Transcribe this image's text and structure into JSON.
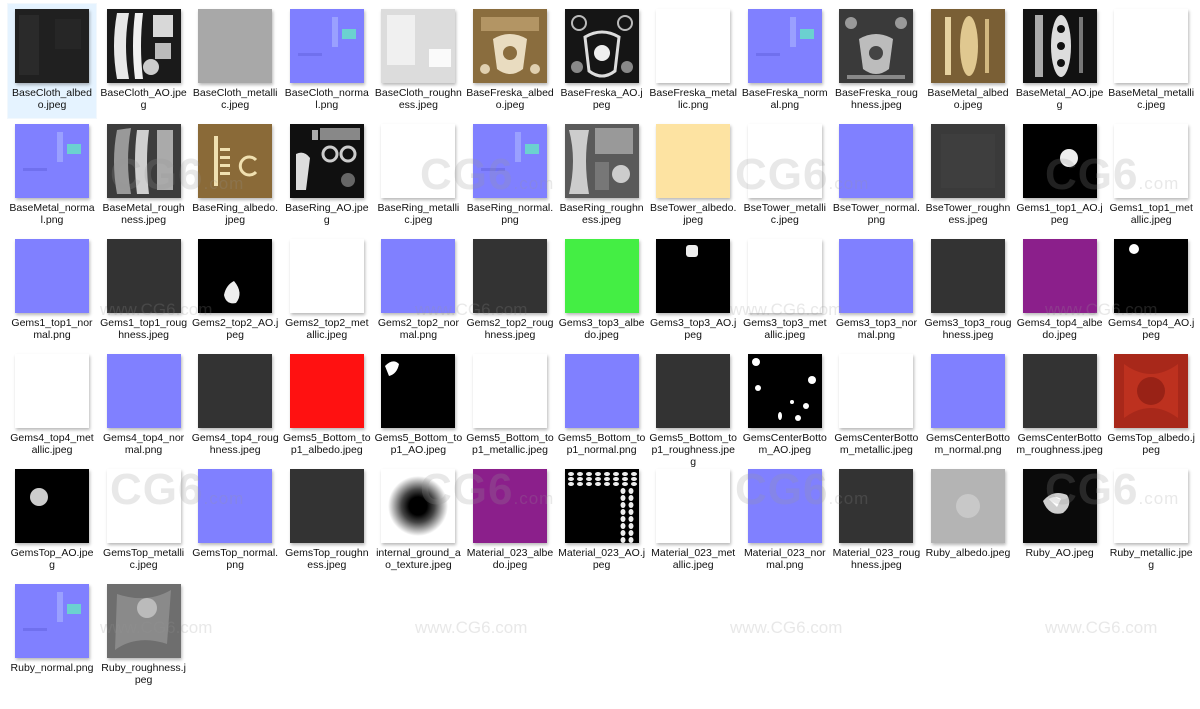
{
  "files": [
    {
      "name": "BaseCloth_albedo.jpeg",
      "selected": true,
      "bg": "#202020",
      "pattern": "dark-cloth"
    },
    {
      "name": "BaseCloth_AO.jpeg",
      "bg": "#1a1a1a",
      "pattern": "ao-cloth"
    },
    {
      "name": "BaseCloth_metallic.jpeg",
      "bg": "#a8a8a8",
      "pattern": "flat"
    },
    {
      "name": "BaseCloth_normal.png",
      "bg": "#7f7fff",
      "pattern": "normal-detail"
    },
    {
      "name": "BaseCloth_roughness.jpeg",
      "bg": "#dcdcdc",
      "pattern": "rough-cloth"
    },
    {
      "name": "BaseFreska_albedo.jpeg",
      "bg": "#8a6d3e",
      "pattern": "freska-gold"
    },
    {
      "name": "BaseFreska_AO.jpeg",
      "bg": "#151515",
      "pattern": "freska-ao"
    },
    {
      "name": "BaseFreska_metallic.png",
      "bg": "#ffffff",
      "pattern": "flat"
    },
    {
      "name": "BaseFreska_normal.png",
      "bg": "#8080ff",
      "pattern": "normal-detail"
    },
    {
      "name": "BaseFreska_roughness.jpeg",
      "bg": "#3a3a3a",
      "pattern": "freska-rough"
    },
    {
      "name": "BaseMetal_albedo.jpeg",
      "bg": "#7a5f35",
      "pattern": "metal-gold"
    },
    {
      "name": "BaseMetal_AO.jpeg",
      "bg": "#111111",
      "pattern": "metal-ao"
    },
    {
      "name": "BaseMetal_metallic.jpeg",
      "bg": "#ffffff",
      "pattern": "flat"
    },
    {
      "name": "BaseMetal_normal.png",
      "bg": "#8080ff",
      "pattern": "normal-detail"
    },
    {
      "name": "BaseMetal_roughness.jpeg",
      "bg": "#3c3c3c",
      "pattern": "metal-rough"
    },
    {
      "name": "BaseRing_albedo.jpeg",
      "bg": "#8a6a38",
      "pattern": "ring-gold"
    },
    {
      "name": "BaseRing_AO.jpeg",
      "bg": "#101010",
      "pattern": "ring-ao"
    },
    {
      "name": "BaseRing_metallic.jpeg",
      "bg": "#ffffff",
      "pattern": "flat"
    },
    {
      "name": "BaseRing_normal.png",
      "bg": "#8080ff",
      "pattern": "normal-detail"
    },
    {
      "name": "BaseRing_roughness.jpeg",
      "bg": "#5a5a5a",
      "pattern": "ring-rough"
    },
    {
      "name": "BseTower_albedo.jpeg",
      "bg": "#fde3a2",
      "pattern": "flat"
    },
    {
      "name": "BseTower_metallic.jpeg",
      "bg": "#ffffff",
      "pattern": "flat"
    },
    {
      "name": "BseTower_normal.png",
      "bg": "#8080ff",
      "pattern": "flat"
    },
    {
      "name": "BseTower_roughness.jpeg",
      "bg": "#3a3a3a",
      "pattern": "noise"
    },
    {
      "name": "Gems1_top1_AO.jpeg",
      "bg": "#000000",
      "pattern": "gem-dot-mid"
    },
    {
      "name": "Gems1_top1_metallic.jpeg",
      "bg": "#ffffff",
      "pattern": "flat"
    },
    {
      "name": "Gems1_top1_normal.png",
      "bg": "#8080ff",
      "pattern": "flat"
    },
    {
      "name": "Gems1_top1_roughness.jpeg",
      "bg": "#333333",
      "pattern": "flat"
    },
    {
      "name": "Gems2_top2_AO.jpeg",
      "bg": "#000000",
      "pattern": "gem-drop"
    },
    {
      "name": "Gems2_top2_metallic.jpeg",
      "bg": "#ffffff",
      "pattern": "flat"
    },
    {
      "name": "Gems2_top2_normal.png",
      "bg": "#8080ff",
      "pattern": "flat"
    },
    {
      "name": "Gems2_top2_roughness.jpeg",
      "bg": "#333333",
      "pattern": "flat"
    },
    {
      "name": "Gems3_top3_albedo.jpeg",
      "bg": "#44ee44",
      "pattern": "flat"
    },
    {
      "name": "Gems3_top3_AO.jpeg",
      "bg": "#000000",
      "pattern": "gem-square"
    },
    {
      "name": "Gems3_top3_metallic.jpeg",
      "bg": "#ffffff",
      "pattern": "flat"
    },
    {
      "name": "Gems3_top3_normal.png",
      "bg": "#8080ff",
      "pattern": "flat"
    },
    {
      "name": "Gems3_top3_roughness.jpeg",
      "bg": "#333333",
      "pattern": "flat"
    },
    {
      "name": "Gems4_top4_albedo.jpeg",
      "bg": "#8b1f8b",
      "pattern": "flat"
    },
    {
      "name": "Gems4_top4_AO.jpeg",
      "bg": "#000000",
      "pattern": "gem-dot-corner"
    },
    {
      "name": "Gems4_top4_metallic.jpeg",
      "bg": "#ffffff",
      "pattern": "flat"
    },
    {
      "name": "Gems4_top4_normal.png",
      "bg": "#8080ff",
      "pattern": "flat"
    },
    {
      "name": "Gems4_top4_roughness.jpeg",
      "bg": "#333333",
      "pattern": "flat"
    },
    {
      "name": "Gems5_Bottom_top1_albedo.jpeg",
      "bg": "#ff1111",
      "pattern": "flat"
    },
    {
      "name": "Gems5_Bottom_top1_AO.jpeg",
      "bg": "#000000",
      "pattern": "gem-blob"
    },
    {
      "name": "Gems5_Bottom_top1_metallic.jpeg",
      "bg": "#ffffff",
      "pattern": "flat"
    },
    {
      "name": "Gems5_Bottom_top1_normal.png",
      "bg": "#8080ff",
      "pattern": "flat"
    },
    {
      "name": "Gems5_Bottom_top1_roughness.jpeg",
      "bg": "#333333",
      "pattern": "flat"
    },
    {
      "name": "GemsCenterBottom_AO.jpeg",
      "bg": "#000000",
      "pattern": "gem-scatter"
    },
    {
      "name": "GemsCenterBottom_metallic.jpeg",
      "bg": "#ffffff",
      "pattern": "flat"
    },
    {
      "name": "GemsCenterBottom_normal.png",
      "bg": "#8080ff",
      "pattern": "flat"
    },
    {
      "name": "GemsCenterBottom_roughness.jpeg",
      "bg": "#333333",
      "pattern": "flat"
    },
    {
      "name": "GemsTop_albedo.jpeg",
      "bg": "#a8281a",
      "pattern": "ruby-red"
    },
    {
      "name": "GemsTop_AO.jpeg",
      "bg": "#000000",
      "pattern": "gem-dot-left"
    },
    {
      "name": "GemsTop_metallic.jpeg",
      "bg": "#ffffff",
      "pattern": "flat"
    },
    {
      "name": "GemsTop_normal.png",
      "bg": "#8080ff",
      "pattern": "flat"
    },
    {
      "name": "GemsTop_roughness.jpeg",
      "bg": "#333333",
      "pattern": "flat"
    },
    {
      "name": "internal_ground_ao_texture.jpeg",
      "bg": "#ffffff",
      "pattern": "radial-ao"
    },
    {
      "name": "Material_023_albedo.jpeg",
      "bg": "#8b1f8b",
      "pattern": "flat"
    },
    {
      "name": "Material_023_AO.jpeg",
      "bg": "#000000",
      "pattern": "scales"
    },
    {
      "name": "Material_023_metallic.jpeg",
      "bg": "#ffffff",
      "pattern": "flat"
    },
    {
      "name": "Material_023_normal.png",
      "bg": "#8080ff",
      "pattern": "flat"
    },
    {
      "name": "Material_023_roughness.jpeg",
      "bg": "#333333",
      "pattern": "flat"
    },
    {
      "name": "Ruby_albedo.jpeg",
      "bg": "#b4b4b4",
      "pattern": "ruby-gray"
    },
    {
      "name": "Ruby_AO.jpeg",
      "bg": "#0a0a0a",
      "pattern": "ruby-ao"
    },
    {
      "name": "Ruby_metallic.jpeg",
      "bg": "#ffffff",
      "pattern": "flat"
    },
    {
      "name": "Ruby_normal.png",
      "bg": "#8080ff",
      "pattern": "normal-detail"
    },
    {
      "name": "Ruby_roughness.jpeg",
      "bg": "#6e6e6e",
      "pattern": "ruby-rough"
    }
  ],
  "watermark": {
    "logo": "CG6",
    "logo_suffix": ".com",
    "url": "www.CG6.com"
  }
}
